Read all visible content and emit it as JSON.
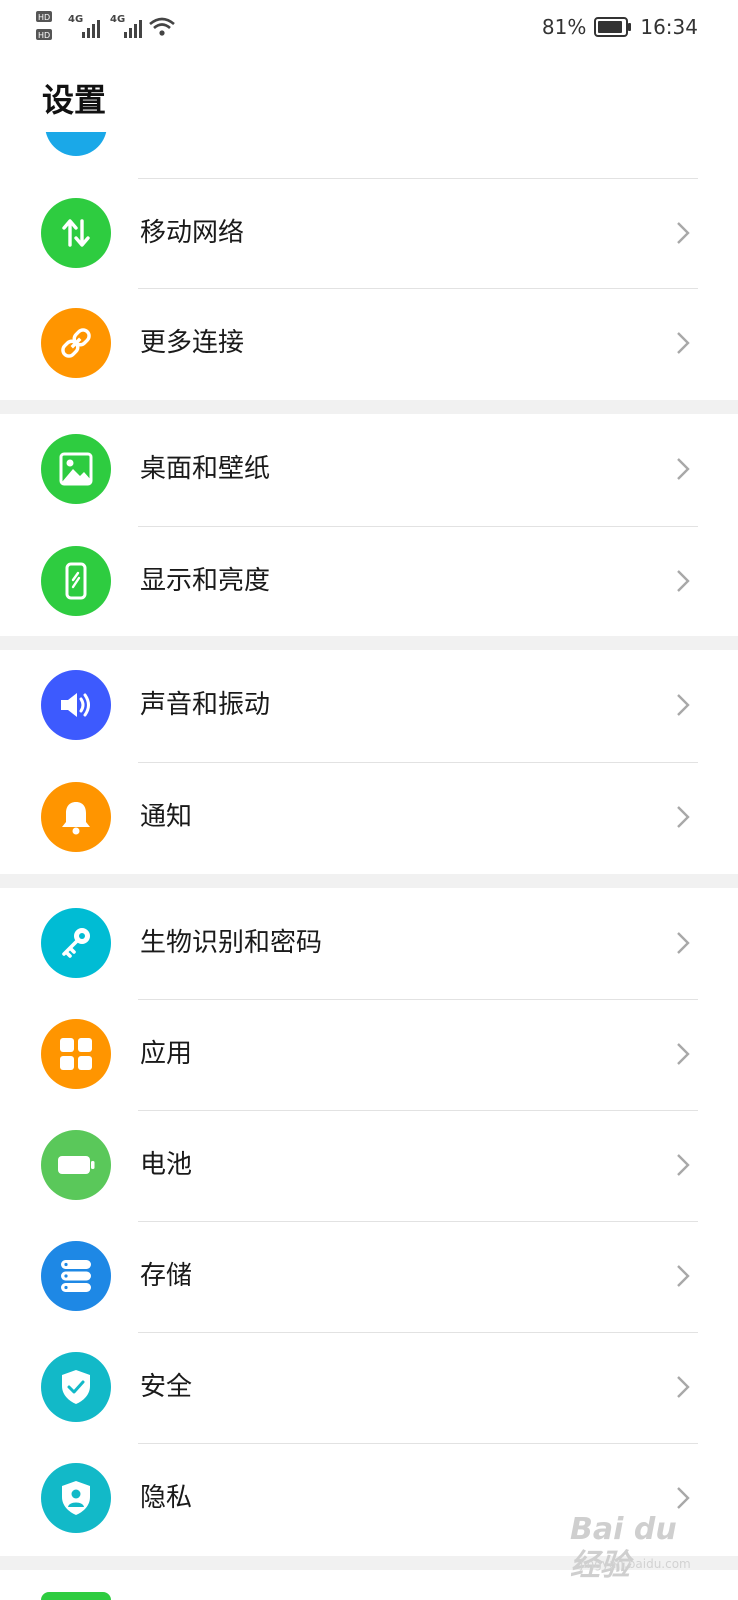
{
  "status_bar": {
    "battery": "81%",
    "time": "16:34",
    "network_1": "4G",
    "network_2": "4G",
    "hd_1": "HD",
    "hd_2": "HD"
  },
  "page": {
    "title": "设置"
  },
  "colors": {
    "blue": "#1aa8e8",
    "green": "#2ecc40",
    "orange": "#ff9500",
    "indigo": "#3d5afe",
    "cyan": "#00bcd4",
    "battery_green": "#5ac85a",
    "storage_blue": "#1e88e5",
    "security_teal": "#12b9c8"
  },
  "groups": [
    {
      "items": [
        {
          "label": "移动网络",
          "icon": "mobile-network-icon"
        },
        {
          "label": "更多连接",
          "icon": "link-icon"
        }
      ]
    },
    {
      "items": [
        {
          "label": "桌面和壁纸",
          "icon": "wallpaper-icon"
        },
        {
          "label": "显示和亮度",
          "icon": "display-icon"
        }
      ]
    },
    {
      "items": [
        {
          "label": "声音和振动",
          "icon": "sound-icon"
        },
        {
          "label": "通知",
          "icon": "bell-icon"
        }
      ]
    },
    {
      "items": [
        {
          "label": "生物识别和密码",
          "icon": "key-icon"
        },
        {
          "label": "应用",
          "icon": "apps-icon"
        },
        {
          "label": "电池",
          "icon": "battery-icon"
        },
        {
          "label": "存储",
          "icon": "storage-icon"
        },
        {
          "label": "安全",
          "icon": "shield-check-icon"
        },
        {
          "label": "隐私",
          "icon": "privacy-icon"
        }
      ]
    }
  ],
  "watermark": {
    "text": "Bai du 经验",
    "sub": "jingyan.baidu.com"
  }
}
